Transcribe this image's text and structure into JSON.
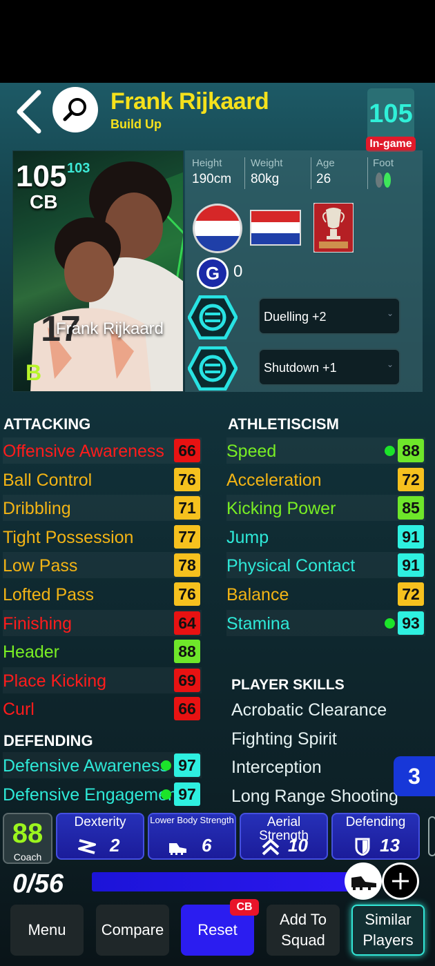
{
  "header": {
    "player_name": "Frank Rijkaard",
    "playstyle": "Build Up",
    "ingame_rating": "105",
    "ingame_label": "In-game"
  },
  "card": {
    "overall": "105",
    "boost": "103",
    "position": "CB",
    "name": "Frank Rijkaard",
    "grade": "B"
  },
  "physical": {
    "height_label": "Height",
    "height": "190cm",
    "weight_label": "Weight",
    "weight": "80kg",
    "age_label": "Age",
    "age": "26",
    "foot_label": "Foot"
  },
  "meta": {
    "g_count": "0",
    "nationality_flag": "netherlands",
    "club_badge": "european-cup-icon"
  },
  "boosters": [
    {
      "label": "Duelling +2"
    },
    {
      "label": "Shutdown +1"
    }
  ],
  "attacking": {
    "title": "ATTACKING",
    "stats": [
      {
        "name": "Offensive Awareness",
        "value": "66",
        "tier": "red"
      },
      {
        "name": "Ball Control",
        "value": "76",
        "tier": "yel"
      },
      {
        "name": "Dribbling",
        "value": "71",
        "tier": "yel"
      },
      {
        "name": "Tight Possession",
        "value": "77",
        "tier": "yel"
      },
      {
        "name": "Low Pass",
        "value": "78",
        "tier": "yel"
      },
      {
        "name": "Lofted Pass",
        "value": "76",
        "tier": "yel"
      },
      {
        "name": "Finishing",
        "value": "64",
        "tier": "red"
      },
      {
        "name": "Header",
        "value": "88",
        "tier": "grn"
      },
      {
        "name": "Place Kicking",
        "value": "69",
        "tier": "red"
      },
      {
        "name": "Curl",
        "value": "66",
        "tier": "red"
      }
    ]
  },
  "defending": {
    "title": "DEFENDING",
    "stats": [
      {
        "name": "Defensive Awareness",
        "value": "97",
        "tier": "cyn"
      },
      {
        "name": "Defensive Engagement",
        "value": "97",
        "tier": "cyn"
      }
    ]
  },
  "athleticism": {
    "title": "ATHLETISCISM",
    "stats": [
      {
        "name": "Speed",
        "value": "88",
        "tier": "grn"
      },
      {
        "name": "Acceleration",
        "value": "72",
        "tier": "yel"
      },
      {
        "name": "Kicking Power",
        "value": "85",
        "tier": "grn"
      },
      {
        "name": "Jump",
        "value": "91",
        "tier": "cyn"
      },
      {
        "name": "Physical Contact",
        "value": "91",
        "tier": "cyn"
      },
      {
        "name": "Balance",
        "value": "72",
        "tier": "yel"
      },
      {
        "name": "Stamina",
        "value": "93",
        "tier": "cyn"
      }
    ]
  },
  "skills": {
    "title": "PLAYER SKILLS",
    "items": [
      "Acrobatic Clearance",
      "Fighting Spirit",
      "Interception",
      "Long Range Shooting"
    ]
  },
  "page_badge": "3",
  "coach": {
    "value": "88",
    "label": "Coach"
  },
  "progression": [
    {
      "label": "Dexterity",
      "value": "2",
      "icon": "dexterity-icon"
    },
    {
      "label": "Lower Body Strength",
      "value": "6",
      "icon": "boot-icon"
    },
    {
      "label": "Aerial Strength",
      "value": "10",
      "icon": "double-chevron-up-icon"
    },
    {
      "label": "Defending",
      "value": "13",
      "icon": "shield-icon"
    }
  ],
  "points": "0/56",
  "bottom_nav": {
    "menu": "Menu",
    "compare": "Compare",
    "reset": "Reset",
    "reset_badge": "CB",
    "add_to_squad_1": "Add To",
    "add_to_squad_2": "Squad",
    "similar_1": "Similar",
    "similar_2": "Players"
  },
  "colors": {
    "name_yellow": "#f5e11c",
    "red": "#e81212",
    "yellow": "#f6c11e",
    "green": "#6ee62a",
    "cyan": "#2ef0e0",
    "reset_blue": "#2b1df0"
  }
}
